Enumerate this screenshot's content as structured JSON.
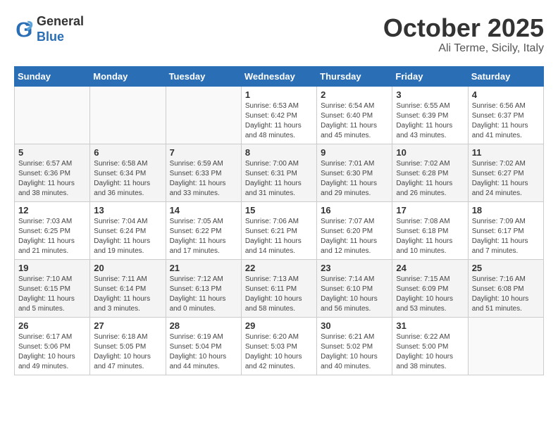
{
  "header": {
    "logo_line1": "General",
    "logo_line2": "Blue",
    "month": "October 2025",
    "location": "Ali Terme, Sicily, Italy"
  },
  "days_of_week": [
    "Sunday",
    "Monday",
    "Tuesday",
    "Wednesday",
    "Thursday",
    "Friday",
    "Saturday"
  ],
  "weeks": [
    [
      {
        "day": "",
        "info": ""
      },
      {
        "day": "",
        "info": ""
      },
      {
        "day": "",
        "info": ""
      },
      {
        "day": "1",
        "info": "Sunrise: 6:53 AM\nSunset: 6:42 PM\nDaylight: 11 hours\nand 48 minutes."
      },
      {
        "day": "2",
        "info": "Sunrise: 6:54 AM\nSunset: 6:40 PM\nDaylight: 11 hours\nand 45 minutes."
      },
      {
        "day": "3",
        "info": "Sunrise: 6:55 AM\nSunset: 6:39 PM\nDaylight: 11 hours\nand 43 minutes."
      },
      {
        "day": "4",
        "info": "Sunrise: 6:56 AM\nSunset: 6:37 PM\nDaylight: 11 hours\nand 41 minutes."
      }
    ],
    [
      {
        "day": "5",
        "info": "Sunrise: 6:57 AM\nSunset: 6:36 PM\nDaylight: 11 hours\nand 38 minutes."
      },
      {
        "day": "6",
        "info": "Sunrise: 6:58 AM\nSunset: 6:34 PM\nDaylight: 11 hours\nand 36 minutes."
      },
      {
        "day": "7",
        "info": "Sunrise: 6:59 AM\nSunset: 6:33 PM\nDaylight: 11 hours\nand 33 minutes."
      },
      {
        "day": "8",
        "info": "Sunrise: 7:00 AM\nSunset: 6:31 PM\nDaylight: 11 hours\nand 31 minutes."
      },
      {
        "day": "9",
        "info": "Sunrise: 7:01 AM\nSunset: 6:30 PM\nDaylight: 11 hours\nand 29 minutes."
      },
      {
        "day": "10",
        "info": "Sunrise: 7:02 AM\nSunset: 6:28 PM\nDaylight: 11 hours\nand 26 minutes."
      },
      {
        "day": "11",
        "info": "Sunrise: 7:02 AM\nSunset: 6:27 PM\nDaylight: 11 hours\nand 24 minutes."
      }
    ],
    [
      {
        "day": "12",
        "info": "Sunrise: 7:03 AM\nSunset: 6:25 PM\nDaylight: 11 hours\nand 21 minutes."
      },
      {
        "day": "13",
        "info": "Sunrise: 7:04 AM\nSunset: 6:24 PM\nDaylight: 11 hours\nand 19 minutes."
      },
      {
        "day": "14",
        "info": "Sunrise: 7:05 AM\nSunset: 6:22 PM\nDaylight: 11 hours\nand 17 minutes."
      },
      {
        "day": "15",
        "info": "Sunrise: 7:06 AM\nSunset: 6:21 PM\nDaylight: 11 hours\nand 14 minutes."
      },
      {
        "day": "16",
        "info": "Sunrise: 7:07 AM\nSunset: 6:20 PM\nDaylight: 11 hours\nand 12 minutes."
      },
      {
        "day": "17",
        "info": "Sunrise: 7:08 AM\nSunset: 6:18 PM\nDaylight: 11 hours\nand 10 minutes."
      },
      {
        "day": "18",
        "info": "Sunrise: 7:09 AM\nSunset: 6:17 PM\nDaylight: 11 hours\nand 7 minutes."
      }
    ],
    [
      {
        "day": "19",
        "info": "Sunrise: 7:10 AM\nSunset: 6:15 PM\nDaylight: 11 hours\nand 5 minutes."
      },
      {
        "day": "20",
        "info": "Sunrise: 7:11 AM\nSunset: 6:14 PM\nDaylight: 11 hours\nand 3 minutes."
      },
      {
        "day": "21",
        "info": "Sunrise: 7:12 AM\nSunset: 6:13 PM\nDaylight: 11 hours\nand 0 minutes."
      },
      {
        "day": "22",
        "info": "Sunrise: 7:13 AM\nSunset: 6:11 PM\nDaylight: 10 hours\nand 58 minutes."
      },
      {
        "day": "23",
        "info": "Sunrise: 7:14 AM\nSunset: 6:10 PM\nDaylight: 10 hours\nand 56 minutes."
      },
      {
        "day": "24",
        "info": "Sunrise: 7:15 AM\nSunset: 6:09 PM\nDaylight: 10 hours\nand 53 minutes."
      },
      {
        "day": "25",
        "info": "Sunrise: 7:16 AM\nSunset: 6:08 PM\nDaylight: 10 hours\nand 51 minutes."
      }
    ],
    [
      {
        "day": "26",
        "info": "Sunrise: 6:17 AM\nSunset: 5:06 PM\nDaylight: 10 hours\nand 49 minutes."
      },
      {
        "day": "27",
        "info": "Sunrise: 6:18 AM\nSunset: 5:05 PM\nDaylight: 10 hours\nand 47 minutes."
      },
      {
        "day": "28",
        "info": "Sunrise: 6:19 AM\nSunset: 5:04 PM\nDaylight: 10 hours\nand 44 minutes."
      },
      {
        "day": "29",
        "info": "Sunrise: 6:20 AM\nSunset: 5:03 PM\nDaylight: 10 hours\nand 42 minutes."
      },
      {
        "day": "30",
        "info": "Sunrise: 6:21 AM\nSunset: 5:02 PM\nDaylight: 10 hours\nand 40 minutes."
      },
      {
        "day": "31",
        "info": "Sunrise: 6:22 AM\nSunset: 5:00 PM\nDaylight: 10 hours\nand 38 minutes."
      },
      {
        "day": "",
        "info": ""
      }
    ]
  ]
}
